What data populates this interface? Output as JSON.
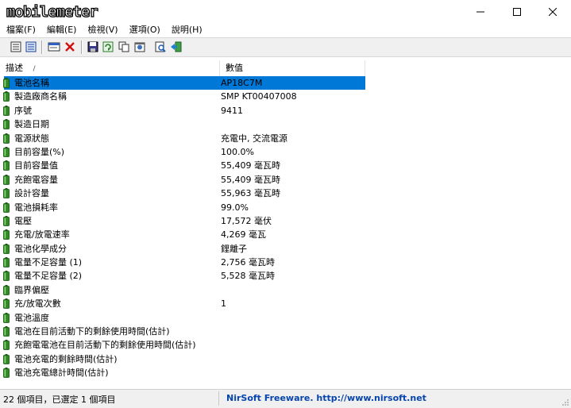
{
  "window": {
    "logo_text": "mobilemeter"
  },
  "menu": [
    {
      "label": "檔案(F)"
    },
    {
      "label": "編輯(E)"
    },
    {
      "label": "檢視(V)"
    },
    {
      "label": "選項(O)"
    },
    {
      "label": "說明(H)"
    }
  ],
  "toolbar": [
    {
      "icon": "view-list-icon"
    },
    {
      "icon": "view-details-icon"
    },
    {
      "icon": "properties-icon"
    },
    {
      "icon": "delete-x-icon"
    },
    {
      "icon": "save-icon"
    },
    {
      "icon": "refresh-icon"
    },
    {
      "icon": "copy-icon"
    },
    {
      "icon": "html-report-icon"
    },
    {
      "icon": "find-icon"
    },
    {
      "icon": "exit-icon"
    }
  ],
  "columns": {
    "desc": "描述",
    "value": "數值",
    "sort_indicator": "/"
  },
  "rows": [
    {
      "desc": "電池名稱",
      "value": "AP18C7M",
      "selected": true
    },
    {
      "desc": "製造廠商名稱",
      "value": "SMP KT00407008"
    },
    {
      "desc": "序號",
      "value": "9411"
    },
    {
      "desc": "製造日期",
      "value": ""
    },
    {
      "desc": "電源狀態",
      "value": "充電中, 交流電源"
    },
    {
      "desc": "目前容量(%)",
      "value": "100.0%"
    },
    {
      "desc": "目前容量值",
      "value": "55,409 毫瓦時"
    },
    {
      "desc": "充飽電容量",
      "value": "55,409 毫瓦時"
    },
    {
      "desc": "設計容量",
      "value": "55,963 毫瓦時"
    },
    {
      "desc": "電池損耗率",
      "value": "99.0%"
    },
    {
      "desc": "電壓",
      "value": "17,572 毫伏"
    },
    {
      "desc": "充電/放電速率",
      "value": "4,269 毫瓦"
    },
    {
      "desc": "電池化學成分",
      "value": "鋰離子"
    },
    {
      "desc": "電量不足容量 (1)",
      "value": "2,756 毫瓦時"
    },
    {
      "desc": "電量不足容量 (2)",
      "value": "5,528 毫瓦時"
    },
    {
      "desc": "臨界偏壓",
      "value": ""
    },
    {
      "desc": "充/放電次數",
      "value": "1"
    },
    {
      "desc": "電池溫度",
      "value": ""
    },
    {
      "desc": "電池在目前活動下的剩餘使用時間(估計)",
      "value": ""
    },
    {
      "desc": "充飽電電池在目前活動下的剩餘使用時間(估計)",
      "value": ""
    },
    {
      "desc": "電池充電的剩餘時間(估計)",
      "value": ""
    },
    {
      "desc": "電池充電總計時間(估計)",
      "value": ""
    }
  ],
  "status": {
    "items": "22 個項目，已選定 1 個項目",
    "credit": "NirSoft Freeware.  http://www.nirsoft.net"
  },
  "colors": {
    "selection": "#0078d7",
    "battery_green": "#2e8b22",
    "link": "#0645ad"
  }
}
